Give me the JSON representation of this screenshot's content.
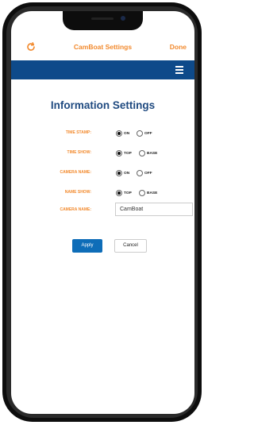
{
  "header": {
    "title": "CamBoat Settings",
    "done_label": "Done"
  },
  "page": {
    "heading": "Information Settings"
  },
  "settings": [
    {
      "label": "TIME STAMP:",
      "options": [
        "ON",
        "OFF"
      ],
      "selected": "ON"
    },
    {
      "label": "TIME SHOW:",
      "options": [
        "TOP",
        "BASE"
      ],
      "selected": "TOP"
    },
    {
      "label": "CAMERA NAME:",
      "options": [
        "ON",
        "OFF"
      ],
      "selected": "ON"
    },
    {
      "label": "NAME SHOW:",
      "options": [
        "TOP",
        "BASE"
      ],
      "selected": "TOP"
    }
  ],
  "camera_name_field": {
    "label": "CAMERA NAME:",
    "value": "CamBoat"
  },
  "buttons": {
    "apply": "Apply",
    "cancel": "Cancel"
  },
  "colors": {
    "accent": "#f28a2e",
    "navbar": "#0e4a8a",
    "heading": "#1f4a80",
    "apply": "#0e6db8"
  },
  "icons": {
    "refresh": "refresh-icon",
    "menu": "hamburger-menu-icon"
  }
}
